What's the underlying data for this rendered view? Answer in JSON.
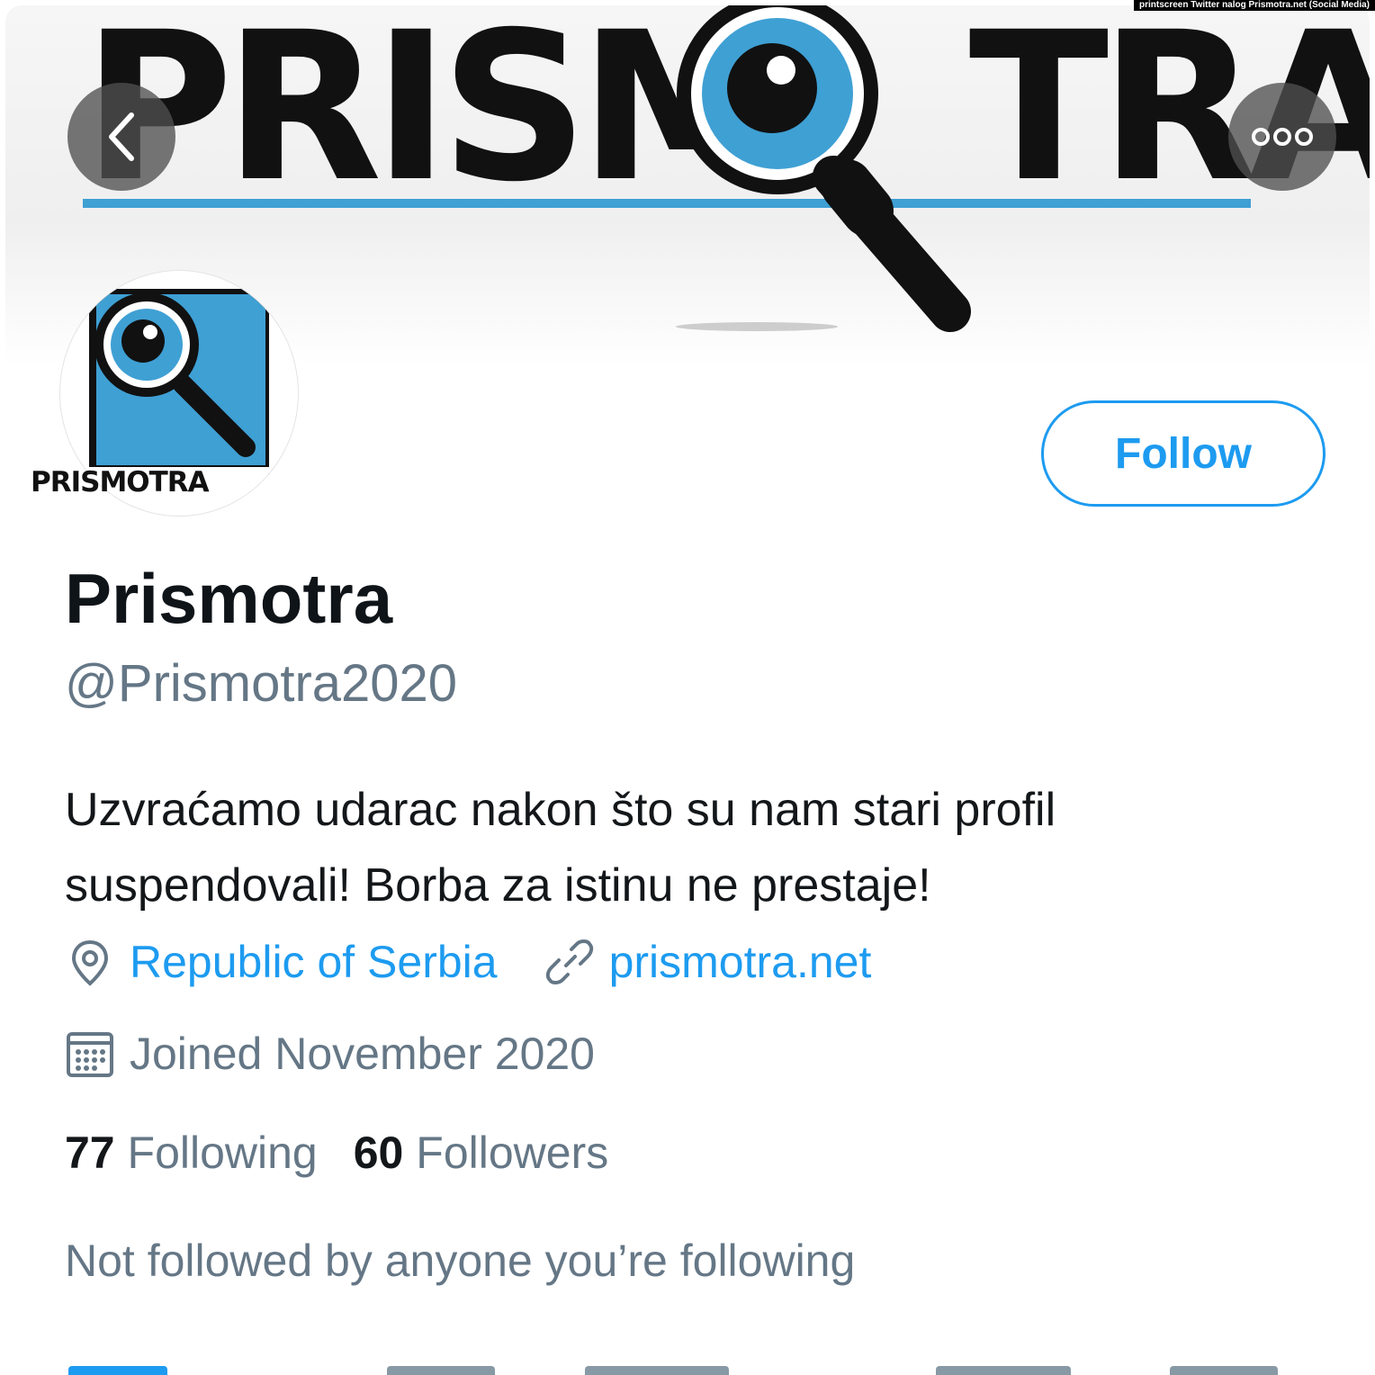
{
  "credit": "printscreen Twitter nalog Prismotra.net (Social Media)",
  "header": {
    "banner_word_left": "PRISM",
    "banner_word_right": "TRA",
    "back_icon": "chevron-left-icon",
    "more_icon": "more-dots-icon"
  },
  "avatar": {
    "text": "PRISMOTRA"
  },
  "follow_button": {
    "label": "Follow"
  },
  "profile": {
    "name": "Prismotra",
    "handle": "@Prismotra2020",
    "bio_line1": "Uzvraćamo udarac nakon što su nam stari profil",
    "bio_line2": "suspendovali! Borba za istinu ne prestaje!",
    "location": "Republic of Serbia",
    "website": "prismotra.net",
    "joined": "Joined November 2020",
    "following_count": "77",
    "following_label": "Following",
    "followers_count": "60",
    "followers_label": "Followers",
    "not_followed": "Not followed by anyone you’re following"
  },
  "colors": {
    "accent": "#1d9bf0",
    "brand_blue": "#3fa0d4",
    "secondary_text": "#657786"
  }
}
